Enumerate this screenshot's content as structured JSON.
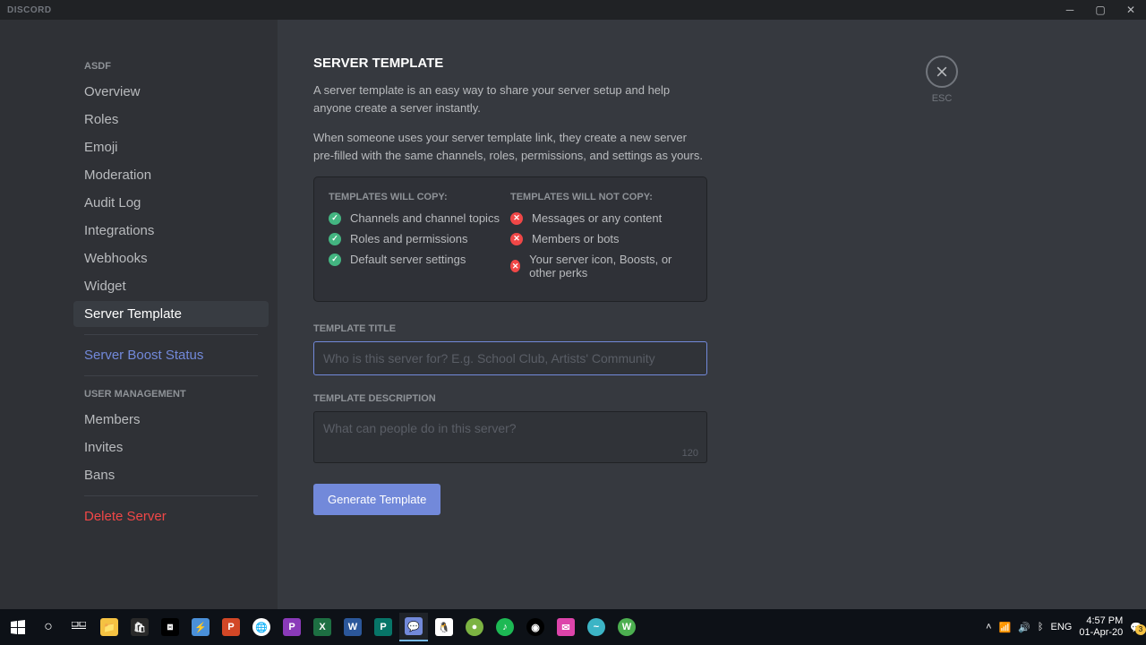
{
  "titlebar": {
    "logo": "DISCORD"
  },
  "sidebar": {
    "server_name": "ASDF",
    "items": [
      {
        "label": "Overview"
      },
      {
        "label": "Roles"
      },
      {
        "label": "Emoji"
      },
      {
        "label": "Moderation"
      },
      {
        "label": "Audit Log"
      },
      {
        "label": "Integrations"
      },
      {
        "label": "Webhooks"
      },
      {
        "label": "Widget"
      },
      {
        "label": "Server Template"
      },
      {
        "label": "Server Boost Status"
      }
    ],
    "user_mgmt_heading": "USER MANAGEMENT",
    "user_mgmt": [
      {
        "label": "Members"
      },
      {
        "label": "Invites"
      },
      {
        "label": "Bans"
      }
    ],
    "delete_label": "Delete Server"
  },
  "content": {
    "esc_label": "ESC",
    "title": "SERVER TEMPLATE",
    "desc1": "A server template is an easy way to share your server setup and help anyone create a server instantly.",
    "desc2": "When someone uses your server template link, they create a new server pre-filled with the same channels, roles, permissions, and settings as yours.",
    "copy_heading": "TEMPLATES WILL COPY:",
    "copy_items": [
      "Channels and channel topics",
      "Roles and permissions",
      "Default server settings"
    ],
    "nocopy_heading": "TEMPLATES WILL NOT COPY:",
    "nocopy_items": [
      "Messages or any content",
      "Members or bots",
      "Your server icon, Boosts, or other perks"
    ],
    "title_label": "TEMPLATE TITLE",
    "title_placeholder": "Who is this server for? E.g. School Club, Artists' Community",
    "desc_label": "TEMPLATE DESCRIPTION",
    "desc_placeholder": "What can people do in this server?",
    "char_count": "120",
    "generate_label": "Generate Template"
  },
  "tray": {
    "lang": "ENG",
    "time": "4:57 PM",
    "date": "01-Apr-20",
    "notif": "3"
  }
}
